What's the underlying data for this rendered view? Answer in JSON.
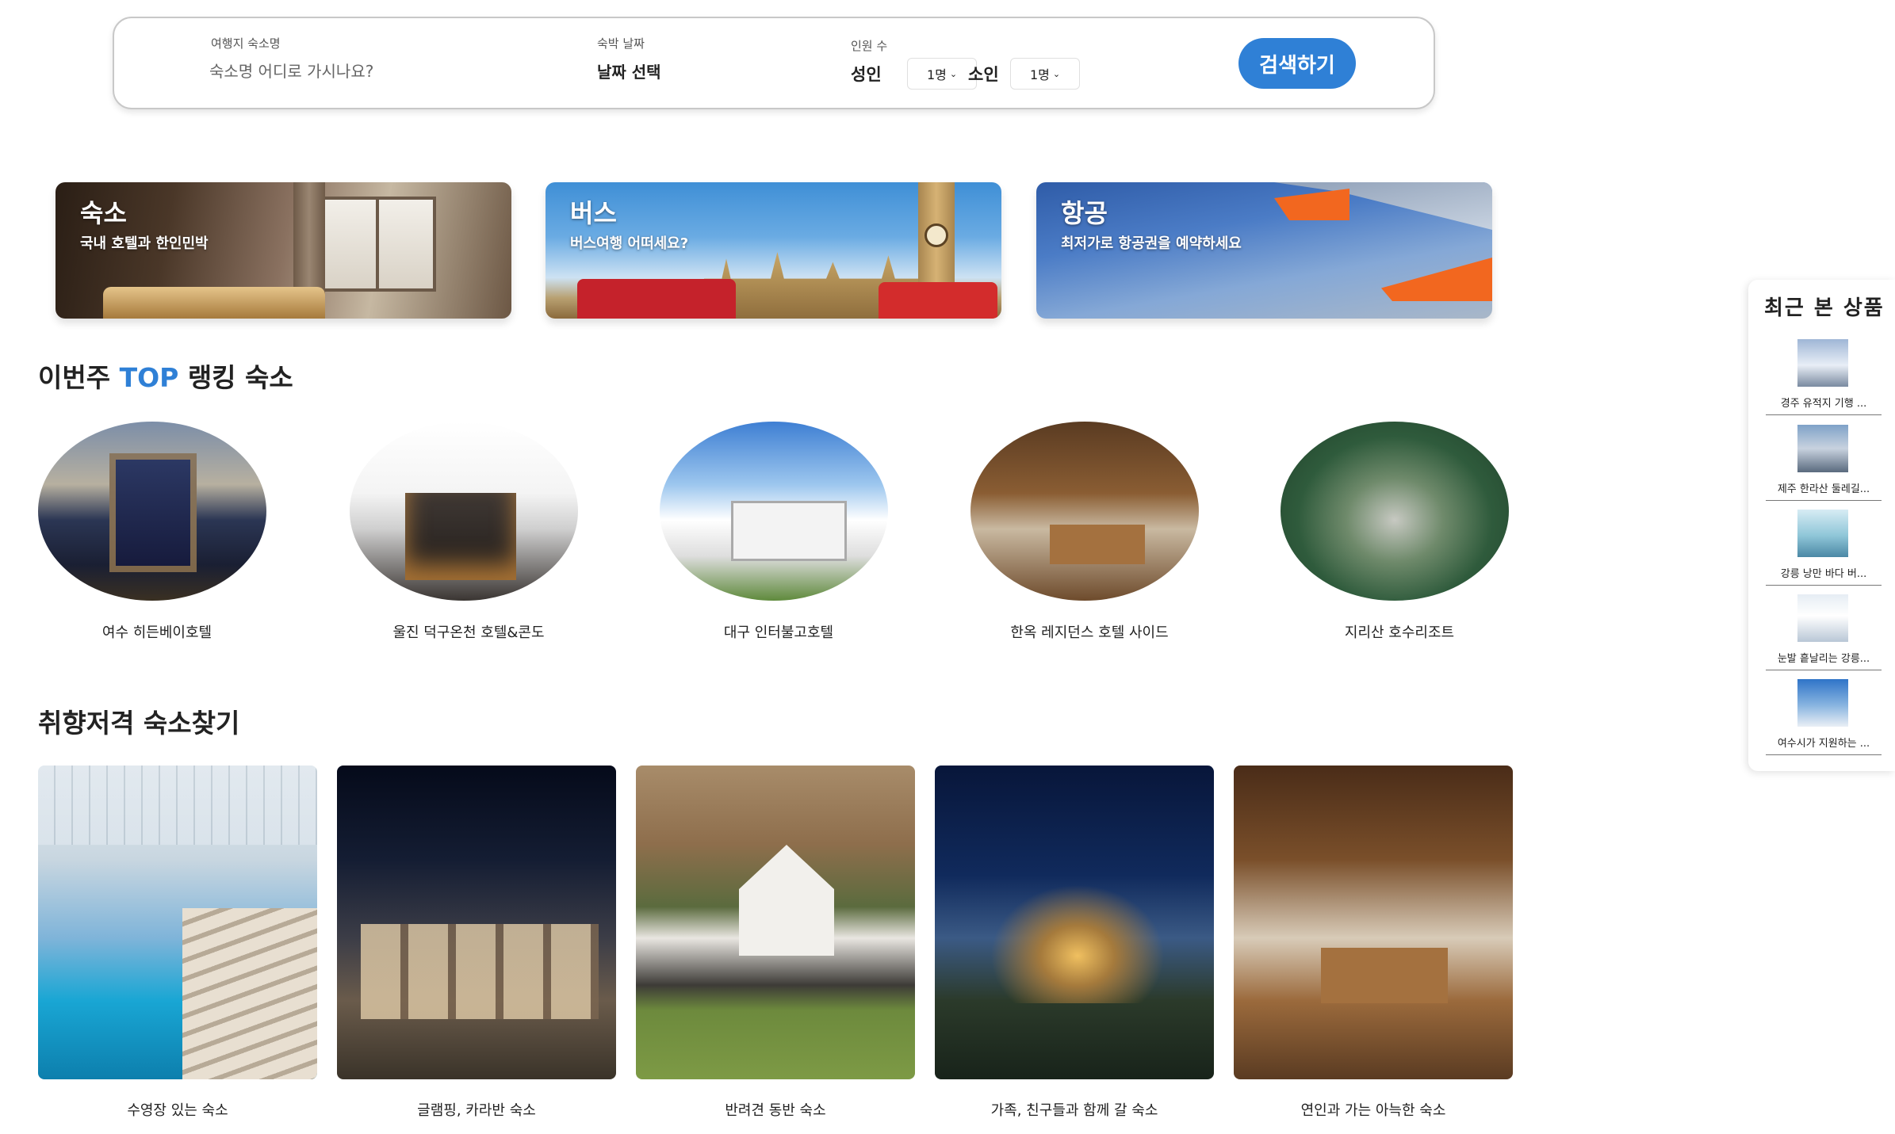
{
  "search": {
    "destination_label": "여행지 숙소명",
    "destination_placeholder": "숙소명 어디로 가시나요?",
    "date_label": "숙박 날짜",
    "date_value": "날짜 선택",
    "guest_label": "인원 수",
    "adult_label": "성인",
    "adult_count": "1명",
    "child_label": "소인",
    "child_count": "1명",
    "button_label": "검색하기"
  },
  "banners": [
    {
      "title": "숙소",
      "subtitle": "국내 호텔과 한인민박"
    },
    {
      "title": "버스",
      "subtitle": "버스여행 어떠세요?"
    },
    {
      "title": "항공",
      "subtitle": "최저가로 항공권을 예약하세요"
    }
  ],
  "ranking": {
    "title_prefix": "이번주 ",
    "title_accent": "TOP",
    "title_suffix": " 랭킹 숙소",
    "items": [
      {
        "name": "여수 히든베이호텔"
      },
      {
        "name": "울진 덕구온천 호텔&콘도"
      },
      {
        "name": "대구 인터불고호텔"
      },
      {
        "name": "한옥 레지던스 호텔 사이드"
      },
      {
        "name": "지리산 호수리조트"
      }
    ]
  },
  "taste": {
    "title": "취향저격 숙소찾기",
    "items": [
      {
        "name": "수영장 있는 숙소"
      },
      {
        "name": "글램핑, 카라반 숙소"
      },
      {
        "name": "반려견 동반 숙소"
      },
      {
        "name": "가족, 친구들과 함께 갈 숙소"
      },
      {
        "name": "연인과 가는 아늑한 숙소"
      }
    ]
  },
  "recent": {
    "title": "최근 본 상품",
    "items": [
      {
        "label": "경주 유적지 기행 ..."
      },
      {
        "label": "제주 한라산 둘레길..."
      },
      {
        "label": "강릉 낭만 바다 버..."
      },
      {
        "label": "눈발 흩날리는 강릉..."
      },
      {
        "label": "여수시가 지원하는 ..."
      }
    ]
  },
  "colors": {
    "accent": "#2f80d6",
    "search_button": "#2f80d6"
  }
}
